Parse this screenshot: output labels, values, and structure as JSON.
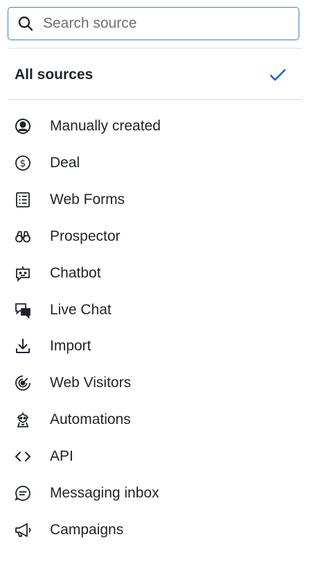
{
  "search": {
    "placeholder": "Search source",
    "value": ""
  },
  "all_sources": {
    "label": "All sources",
    "selected": true,
    "check_color": "#1d63c2"
  },
  "sources": [
    {
      "label": "Manually created",
      "icon": "person-circle-icon"
    },
    {
      "label": "Deal",
      "icon": "dollar-circle-icon"
    },
    {
      "label": "Web Forms",
      "icon": "form-list-icon"
    },
    {
      "label": "Prospector",
      "icon": "binoculars-icon"
    },
    {
      "label": "Chatbot",
      "icon": "chatbot-icon"
    },
    {
      "label": "Live Chat",
      "icon": "live-chat-icon"
    },
    {
      "label": "Import",
      "icon": "download-icon"
    },
    {
      "label": "Web Visitors",
      "icon": "radar-icon"
    },
    {
      "label": "Automations",
      "icon": "robot-icon"
    },
    {
      "label": "API",
      "icon": "code-icon"
    },
    {
      "label": "Messaging inbox",
      "icon": "message-bubble-icon"
    },
    {
      "label": "Campaigns",
      "icon": "megaphone-icon"
    }
  ]
}
